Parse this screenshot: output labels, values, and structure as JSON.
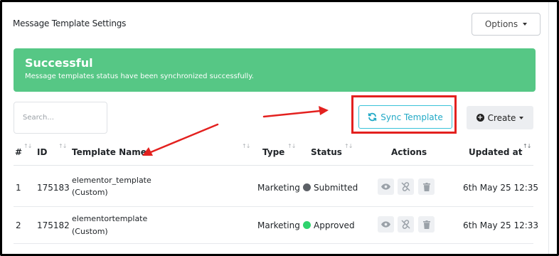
{
  "header": {
    "title": "Message Template Settings",
    "options_label": "Options"
  },
  "alert": {
    "title": "Successful",
    "message": "Message templates status have been synchronized successfully."
  },
  "search": {
    "placeholder": "Search..."
  },
  "toolbar": {
    "sync_label": "Sync Template",
    "create_label": "Create"
  },
  "table": {
    "columns": [
      "#",
      "ID",
      "Template Name",
      "Type",
      "Status",
      "Actions",
      "Updated at"
    ],
    "rows": [
      {
        "num": "1",
        "id": "175183",
        "name": "elementor_template",
        "name_sub": "(Custom)",
        "type": "Marketing",
        "status": "Submitted",
        "status_color": "#5c6066",
        "updated": "6th May 25 12:35"
      },
      {
        "num": "2",
        "id": "175182",
        "name": "elementortemplate",
        "name_sub": "(Custom)",
        "type": "Marketing",
        "status": "Approved",
        "status_color": "#2fd36d",
        "updated": "6th May 25 12:33"
      }
    ]
  },
  "colors": {
    "success_bg": "#56c785",
    "accent_cyan": "#21a9c6",
    "highlight_red": "#e3211f"
  },
  "icons": [
    "caret-down-icon",
    "sync-icon",
    "plus-circle-icon",
    "sort-icon",
    "eye-icon",
    "unlink-icon",
    "trash-icon"
  ]
}
